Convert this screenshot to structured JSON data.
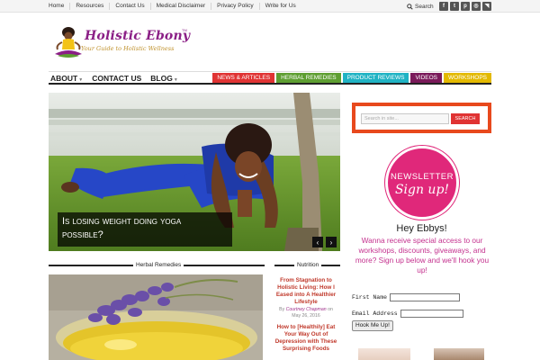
{
  "top_nav": [
    "Home",
    "Resources",
    "Contact Us",
    "Medical Disclaimer",
    "Privacy Policy",
    "Write for Us"
  ],
  "top_search_label": "Search",
  "social_icons": [
    {
      "name": "facebook-icon",
      "glyph": "f"
    },
    {
      "name": "twitter-icon",
      "glyph": "t"
    },
    {
      "name": "pinterest-icon",
      "glyph": "p"
    },
    {
      "name": "instagram-icon",
      "glyph": "◎"
    },
    {
      "name": "rss-icon",
      "glyph": "◥"
    }
  ],
  "logo": {
    "title": "Holistic Ebony",
    "tm": "TM",
    "tagline": "Your Guide to Holistic Wellness"
  },
  "main_nav": [
    {
      "label": "ABOUT",
      "caret": true
    },
    {
      "label": "CONTACT US",
      "caret": false
    },
    {
      "label": "BLOG",
      "caret": true
    }
  ],
  "categories": [
    {
      "label": "News & Articles",
      "color": "#e03333"
    },
    {
      "label": "Herbal Remedies",
      "color": "#5e9e31"
    },
    {
      "label": "Product Reviews",
      "color": "#20b3c4"
    },
    {
      "label": "Videos",
      "color": "#7a1a5a"
    },
    {
      "label": "Workshops",
      "color": "#e3b900"
    }
  ],
  "slider": {
    "caption_line1": "Is losing weight doing yoga",
    "caption_line2": "possible?",
    "prev": "‹",
    "next": "›"
  },
  "sections": {
    "herbal": "Herbal Remedies",
    "nutrition": "Nutrition"
  },
  "nutrition_posts": [
    {
      "title": "From Stagnation to Holistic Living: How I Eased into A Healthier Lifestyle",
      "by": "By",
      "author": "Courtney Chapman",
      "on": "on",
      "date": "May 26, 2016"
    },
    {
      "title": "How to [Healthily] Eat Your Way Out of Depression with These Surprising Foods",
      "by": "",
      "author": "",
      "on": "",
      "date": ""
    }
  ],
  "sidebar": {
    "search_placeholder": "Search in site...",
    "search_button": "SEARCH",
    "newsletter_line1": "NEWSLETTER",
    "newsletter_line2": "Sign up!",
    "greeting": "Hey Ebbys!",
    "pitch": "Wanna receive special access to our workshops, discounts, giveaways, and more? Sign up below and we'll hook you up!",
    "first_name_label": "First Name :",
    "email_label": "Email Address :",
    "submit_label": "Hook Me Up!"
  },
  "colors": {
    "accent": "#e8491d",
    "brand": "#8b1f86",
    "pink": "#e0287a"
  }
}
